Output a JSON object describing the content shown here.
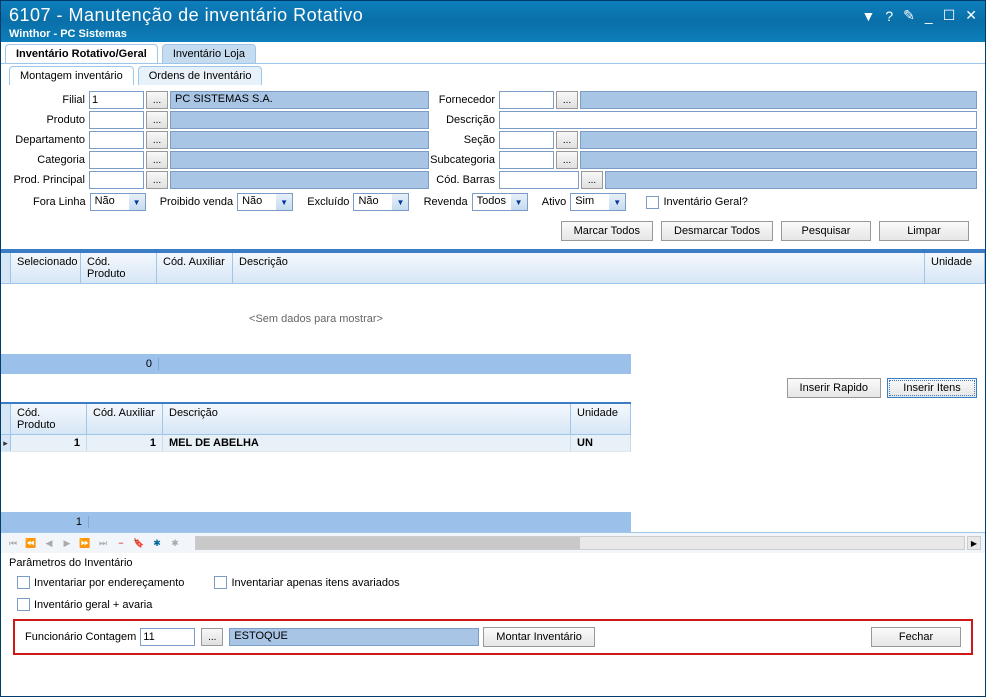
{
  "window": {
    "code": "6107",
    "title": "6107 - Manutenção de inventário Rotativo",
    "subtitle": "Winthor - PC Sistemas"
  },
  "tabs": {
    "main": [
      {
        "label": "Inventário Rotativo/Geral",
        "active": true
      },
      {
        "label": "Inventário Loja",
        "active": false
      }
    ],
    "sub": [
      {
        "label": "Montagem inventário",
        "active": true
      },
      {
        "label": "Ordens de Inventário",
        "active": false
      }
    ]
  },
  "form": {
    "filial_label": "Filial",
    "filial_value": "1",
    "filial_name": "PC SISTEMAS S.A.",
    "fornecedor_label": "Fornecedor",
    "fornecedor_value": "",
    "produto_label": "Produto",
    "descricao_label": "Descrição",
    "departamento_label": "Departamento",
    "secao_label": "Seção",
    "categoria_label": "Categoria",
    "subcategoria_label": "Subcategoria",
    "prod_principal_label": "Prod. Principal",
    "cod_barras_label": "Cód. Barras",
    "fora_linha_label": "Fora Linha",
    "fora_linha_value": "Não",
    "proibido_venda_label": "Proibido venda",
    "proibido_venda_value": "Não",
    "excluido_label": "Excluído",
    "excluido_value": "Não",
    "revenda_label": "Revenda",
    "revenda_value": "Todos",
    "ativo_label": "Ativo",
    "ativo_value": "Sim",
    "inventario_geral_label": "Inventário Geral?"
  },
  "buttons": {
    "marcar_todos": "Marcar Todos",
    "desmarcar_todos": "Desmarcar Todos",
    "pesquisar": "Pesquisar",
    "limpar": "Limpar",
    "inserir_rapido": "Inserir Rapido",
    "inserir_itens": "Inserir Itens",
    "montar_inventario": "Montar Inventário",
    "fechar": "Fechar"
  },
  "grid1": {
    "headers": {
      "selecionado": "Selecionado",
      "cod_produto": "Cód. Produto",
      "cod_auxiliar": "Cód. Auxiliar",
      "descricao": "Descrição",
      "unidade": "Unidade"
    },
    "empty_text": "<Sem dados para mostrar>",
    "footer_value": "0"
  },
  "grid2": {
    "headers": {
      "cod_produto": "Cód. Produto",
      "cod_auxiliar": "Cód. Auxiliar",
      "descricao": "Descrição",
      "unidade": "Unidade"
    },
    "rows": [
      {
        "cod_produto": "1",
        "cod_auxiliar": "1",
        "descricao": "MEL DE ABELHA",
        "unidade": "UN"
      }
    ],
    "footer_value": "1"
  },
  "params": {
    "title": "Parâmetros do Inventário",
    "inv_enderecamento": "Inventariar por endereçamento",
    "inv_avariados": "Inventariar apenas itens avariados",
    "inv_geral_avaria": "Inventário geral + avaria"
  },
  "bottom": {
    "funcionario_label": "Funcionário Contagem",
    "funcionario_value": "11",
    "funcionario_name": "ESTOQUE"
  },
  "icons": {
    "ellipsis": "...",
    "triangle_down": "▼",
    "question": "?",
    "edit": "✎",
    "minimize": "_",
    "maximize": "☐",
    "close": "✕"
  }
}
